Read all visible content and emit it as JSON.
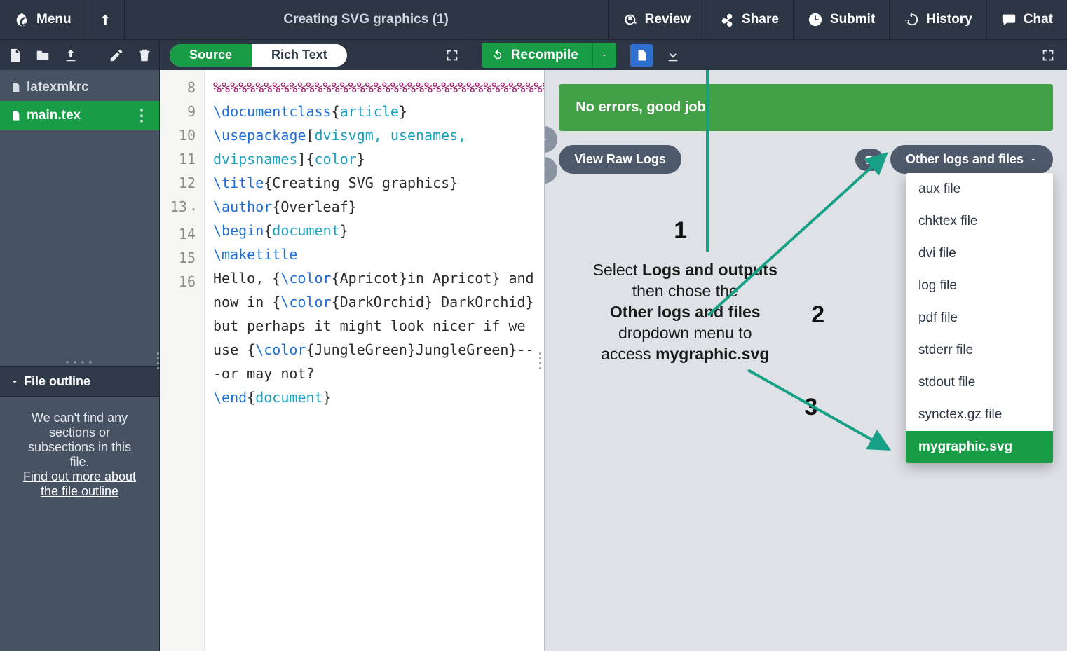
{
  "topbar": {
    "menu": "Menu",
    "title": "Creating SVG graphics (1)",
    "review": "Review",
    "share": "Share",
    "submit": "Submit",
    "history": "History",
    "chat": "Chat"
  },
  "editorToolbar": {
    "mode_source": "Source",
    "mode_rich": "Rich Text"
  },
  "pdfToolbar": {
    "recompile": "Recompile"
  },
  "files": {
    "items": [
      {
        "name": "latexmkrc",
        "active": false
      },
      {
        "name": "main.tex",
        "active": true
      }
    ]
  },
  "outline": {
    "header": "File outline",
    "body_pre": "We can't find any sections or subsections in this file.",
    "body_link": "Find out more about the file outline"
  },
  "editor": {
    "lines": [
      {
        "n": 8,
        "html": "<span class='c-cmt'>%%%%%%%%%%%%%%%%%%%%%%%%%%%%%%%%%%%%%%%%%%%%%%%%%%%%%%%%%%%%%%%%%%%%%%%%%%%%%%%%%%%%%%%</span>"
      },
      {
        "n": 9,
        "html": "<span class='c-key'>\\documentclass</span>{<span class='c-arg'>article</span>}"
      },
      {
        "n": 10,
        "html": "<span class='c-key'>\\usepackage</span>[<span class='c-arg'>dvisvgm, usenames, dvipsnames</span>]{<span class='c-arg'>color</span>}"
      },
      {
        "n": 11,
        "html": "<span class='c-key'>\\title</span>{Creating SVG graphics}"
      },
      {
        "n": 12,
        "html": "<span class='c-key'>\\author</span>{Overleaf}"
      },
      {
        "n": 13,
        "html": "<span class='c-key'>\\begin</span>{<span class='c-arg'>document</span>}",
        "fold": true
      },
      {
        "n": 14,
        "html": "<span class='c-key'>\\maketitle</span>"
      },
      {
        "n": 15,
        "html": "Hello, {<span class='c-key'>\\color</span>{Apricot}in Apricot} and now in {<span class='c-key'>\\color</span>{DarkOrchid} DarkOrchid} but perhaps it might look nicer if we use {<span class='c-key'>\\color</span>{JungleGreen}JungleGreen}---or may not?"
      },
      {
        "n": 16,
        "html": "<span class='c-key'>\\end</span>{<span class='c-arg'>document</span>}"
      }
    ]
  },
  "logs": {
    "ok_msg": "No errors, good job!",
    "view_raw": "View Raw Logs",
    "other_label": "Other logs and files",
    "dropdown": [
      "aux file",
      "chktex file",
      "dvi file",
      "log file",
      "pdf file",
      "stderr file",
      "stdout file",
      "synctex.gz file",
      "mygraphic.svg"
    ],
    "highlight_index": 8
  },
  "annotation": {
    "n1": "1",
    "n2": "2",
    "n3": "3",
    "line1": "Select",
    "b1": "Logs and outputs",
    "line2": "then chose the",
    "b2": "Other logs and files",
    "line3": "dropdown menu to",
    "line4_a": "access",
    "b3": "mygraphic.svg"
  }
}
